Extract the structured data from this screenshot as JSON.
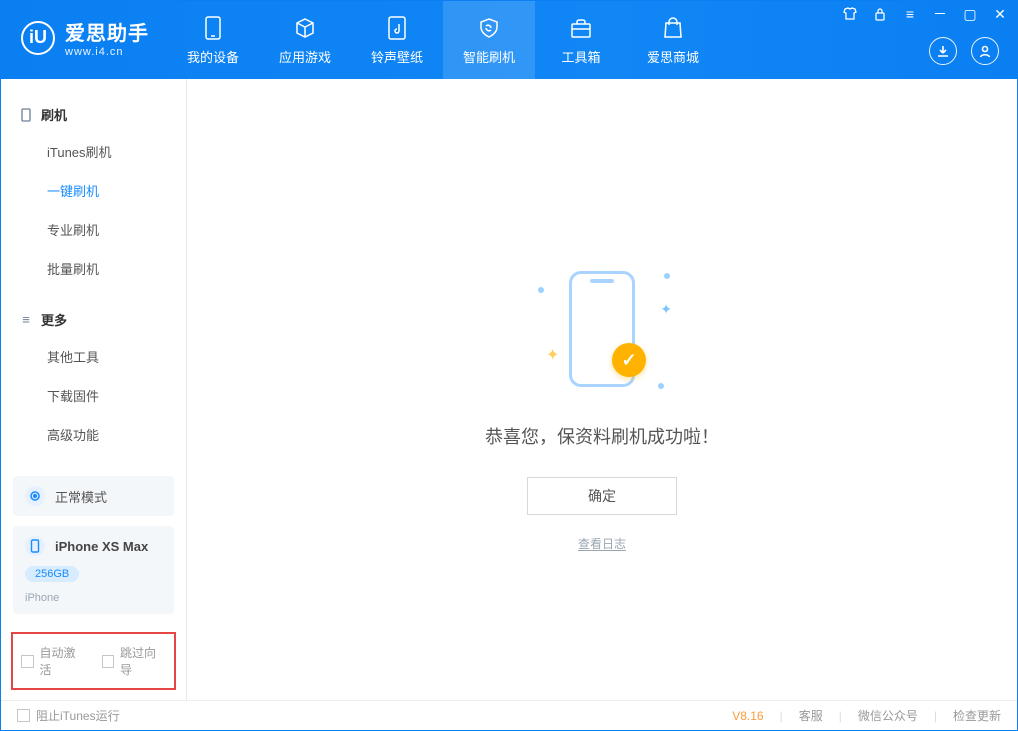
{
  "app": {
    "title": "爱思助手",
    "subtitle": "www.i4.cn",
    "logo_letter": "iU"
  },
  "tabs": [
    {
      "label": "我的设备"
    },
    {
      "label": "应用游戏"
    },
    {
      "label": "铃声壁纸"
    },
    {
      "label": "智能刷机"
    },
    {
      "label": "工具箱"
    },
    {
      "label": "爱思商城"
    }
  ],
  "sidebar": {
    "group1_title": "刷机",
    "items1": [
      {
        "label": "iTunes刷机"
      },
      {
        "label": "一键刷机"
      },
      {
        "label": "专业刷机"
      },
      {
        "label": "批量刷机"
      }
    ],
    "group2_title": "更多",
    "items2": [
      {
        "label": "其他工具"
      },
      {
        "label": "下载固件"
      },
      {
        "label": "高级功能"
      }
    ],
    "mode": "正常模式",
    "device_name": "iPhone XS Max",
    "storage": "256GB",
    "device_sub": "iPhone",
    "auto_activate": "自动激活",
    "skip_guide": "跳过向导"
  },
  "main": {
    "message": "恭喜您，保资料刷机成功啦！",
    "ok": "确定",
    "view_log": "查看日志"
  },
  "footer": {
    "block_itunes": "阻止iTunes运行",
    "version": "V8.16",
    "support": "客服",
    "wechat": "微信公众号",
    "update": "检查更新"
  }
}
